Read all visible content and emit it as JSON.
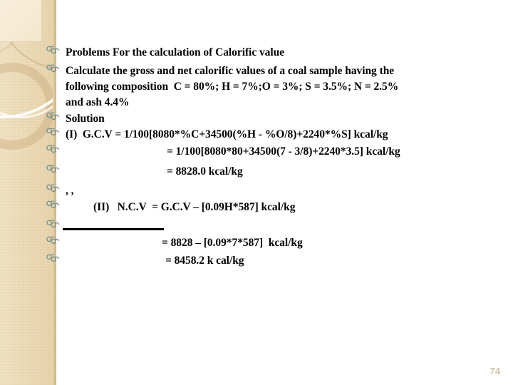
{
  "slide": {
    "page_number": "74",
    "bullet_glyph": "fleuron-80",
    "colors": {
      "band": "#eddcb9",
      "band_edge": "#c9b184",
      "bullet": "#6f8f8e",
      "text": "#000000",
      "page_number": "#cfc3a8",
      "background": "#ffffff"
    },
    "lines": [
      {
        "bullet": true,
        "text": "Problems For the calculation of Calorific value"
      },
      {
        "bullet": true,
        "text": "Calculate the gross and net calorific values of a coal sample having the"
      },
      {
        "bullet": false,
        "text": "following composition  C = 80%; H = 7%;O = 3%; S = 3.5%; N = 2.5%"
      },
      {
        "bullet": false,
        "text": "and ash 4.4%"
      },
      {
        "bullet": true,
        "text": "Solution"
      },
      {
        "bullet": true,
        "text": "(I)  G.C.V = 1/100[8080*%C+34500(%H - %O/8)+2240*%S] kcal/kg"
      },
      {
        "bullet": true,
        "text": "= 1/100[8080*80+34500(7 - 3/8)+2240*3.5] kcal/kg"
      },
      {
        "bullet": true,
        "text": "= 8828.0 kcal/kg"
      },
      {
        "bullet": true,
        "text": ", ,"
      },
      {
        "bullet": true,
        "text": "(II)   N.C.V  = G.C.V – [0.09H*587] kcal/kg"
      },
      {
        "bullet": true,
        "text": "_______"
      },
      {
        "bullet": true,
        "text": "= 8828 – [0.09*7*587]  kcal/kg"
      },
      {
        "bullet": true,
        "text": "= 8458.2 k cal/kg"
      }
    ]
  }
}
